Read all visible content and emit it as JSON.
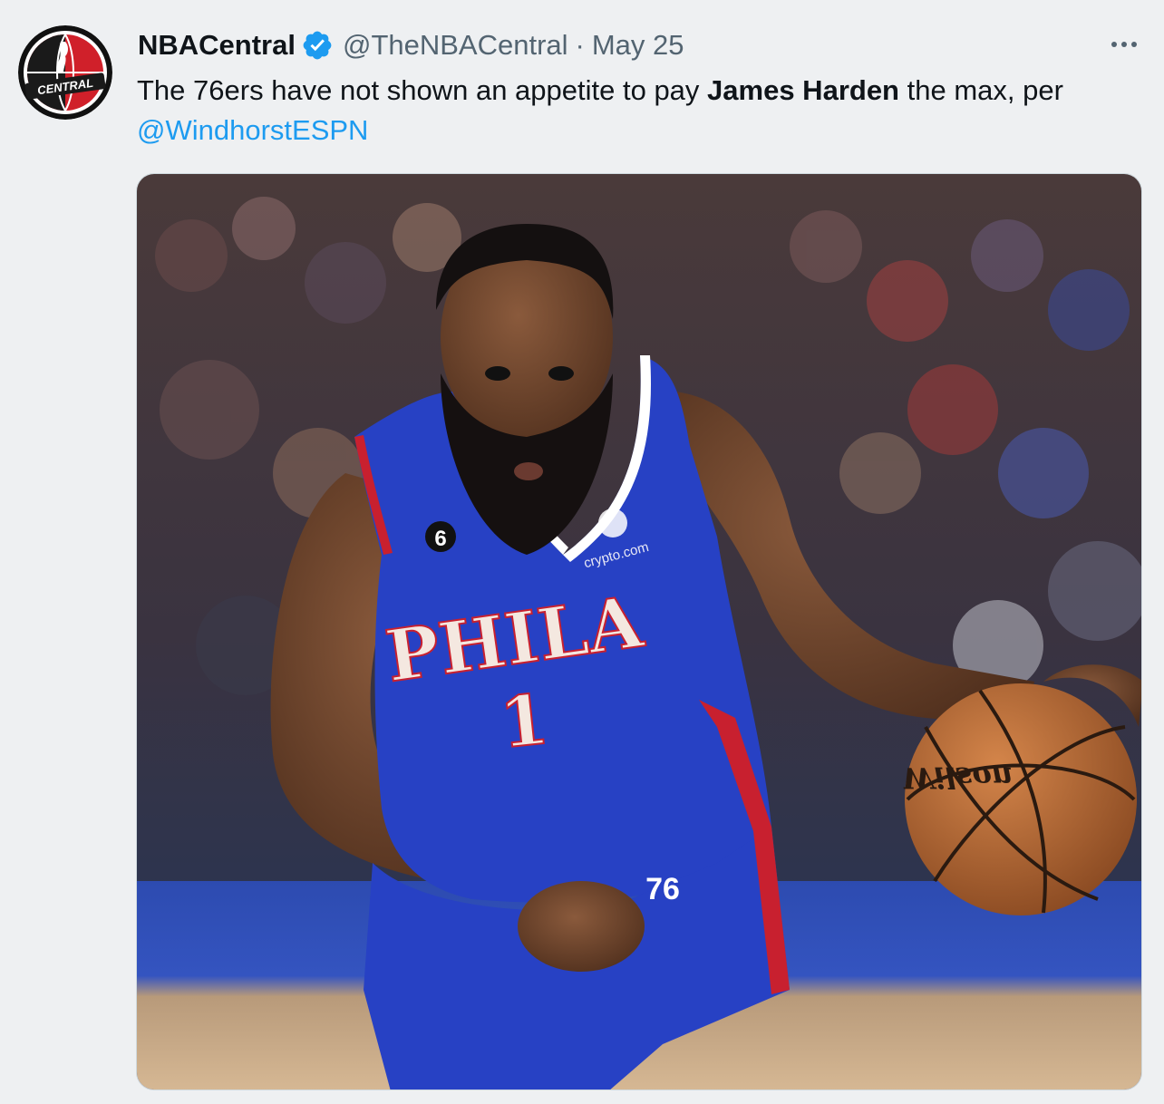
{
  "tweet": {
    "author": {
      "display_name": "NBACentral",
      "handle": "@TheNBACentral",
      "verified": true,
      "avatar_icon": "nba-central-logo-icon",
      "avatar_text": "CENTRAL"
    },
    "separator": "·",
    "date": "May 25",
    "more_icon": "more-horizontal-icon",
    "text": {
      "before_bold": "The 76ers have not shown an appetite to pay ",
      "bold": "James Harden",
      "after_bold": " the max, per",
      "mention": "@WindhorstESPN"
    },
    "media": {
      "jersey_text": "PHILA",
      "jersey_number": "1",
      "patch_number": "6",
      "sponsor": "crypto.com",
      "ball_brand": "Wilson",
      "shorts_text": "76"
    }
  },
  "colors": {
    "background": "#eef0f2",
    "text_primary": "#0f1419",
    "text_secondary": "#536471",
    "link": "#1d9bf0",
    "verified": "#1d9bf0",
    "jersey_blue": "#2741c4",
    "jersey_red": "#c8202f"
  }
}
